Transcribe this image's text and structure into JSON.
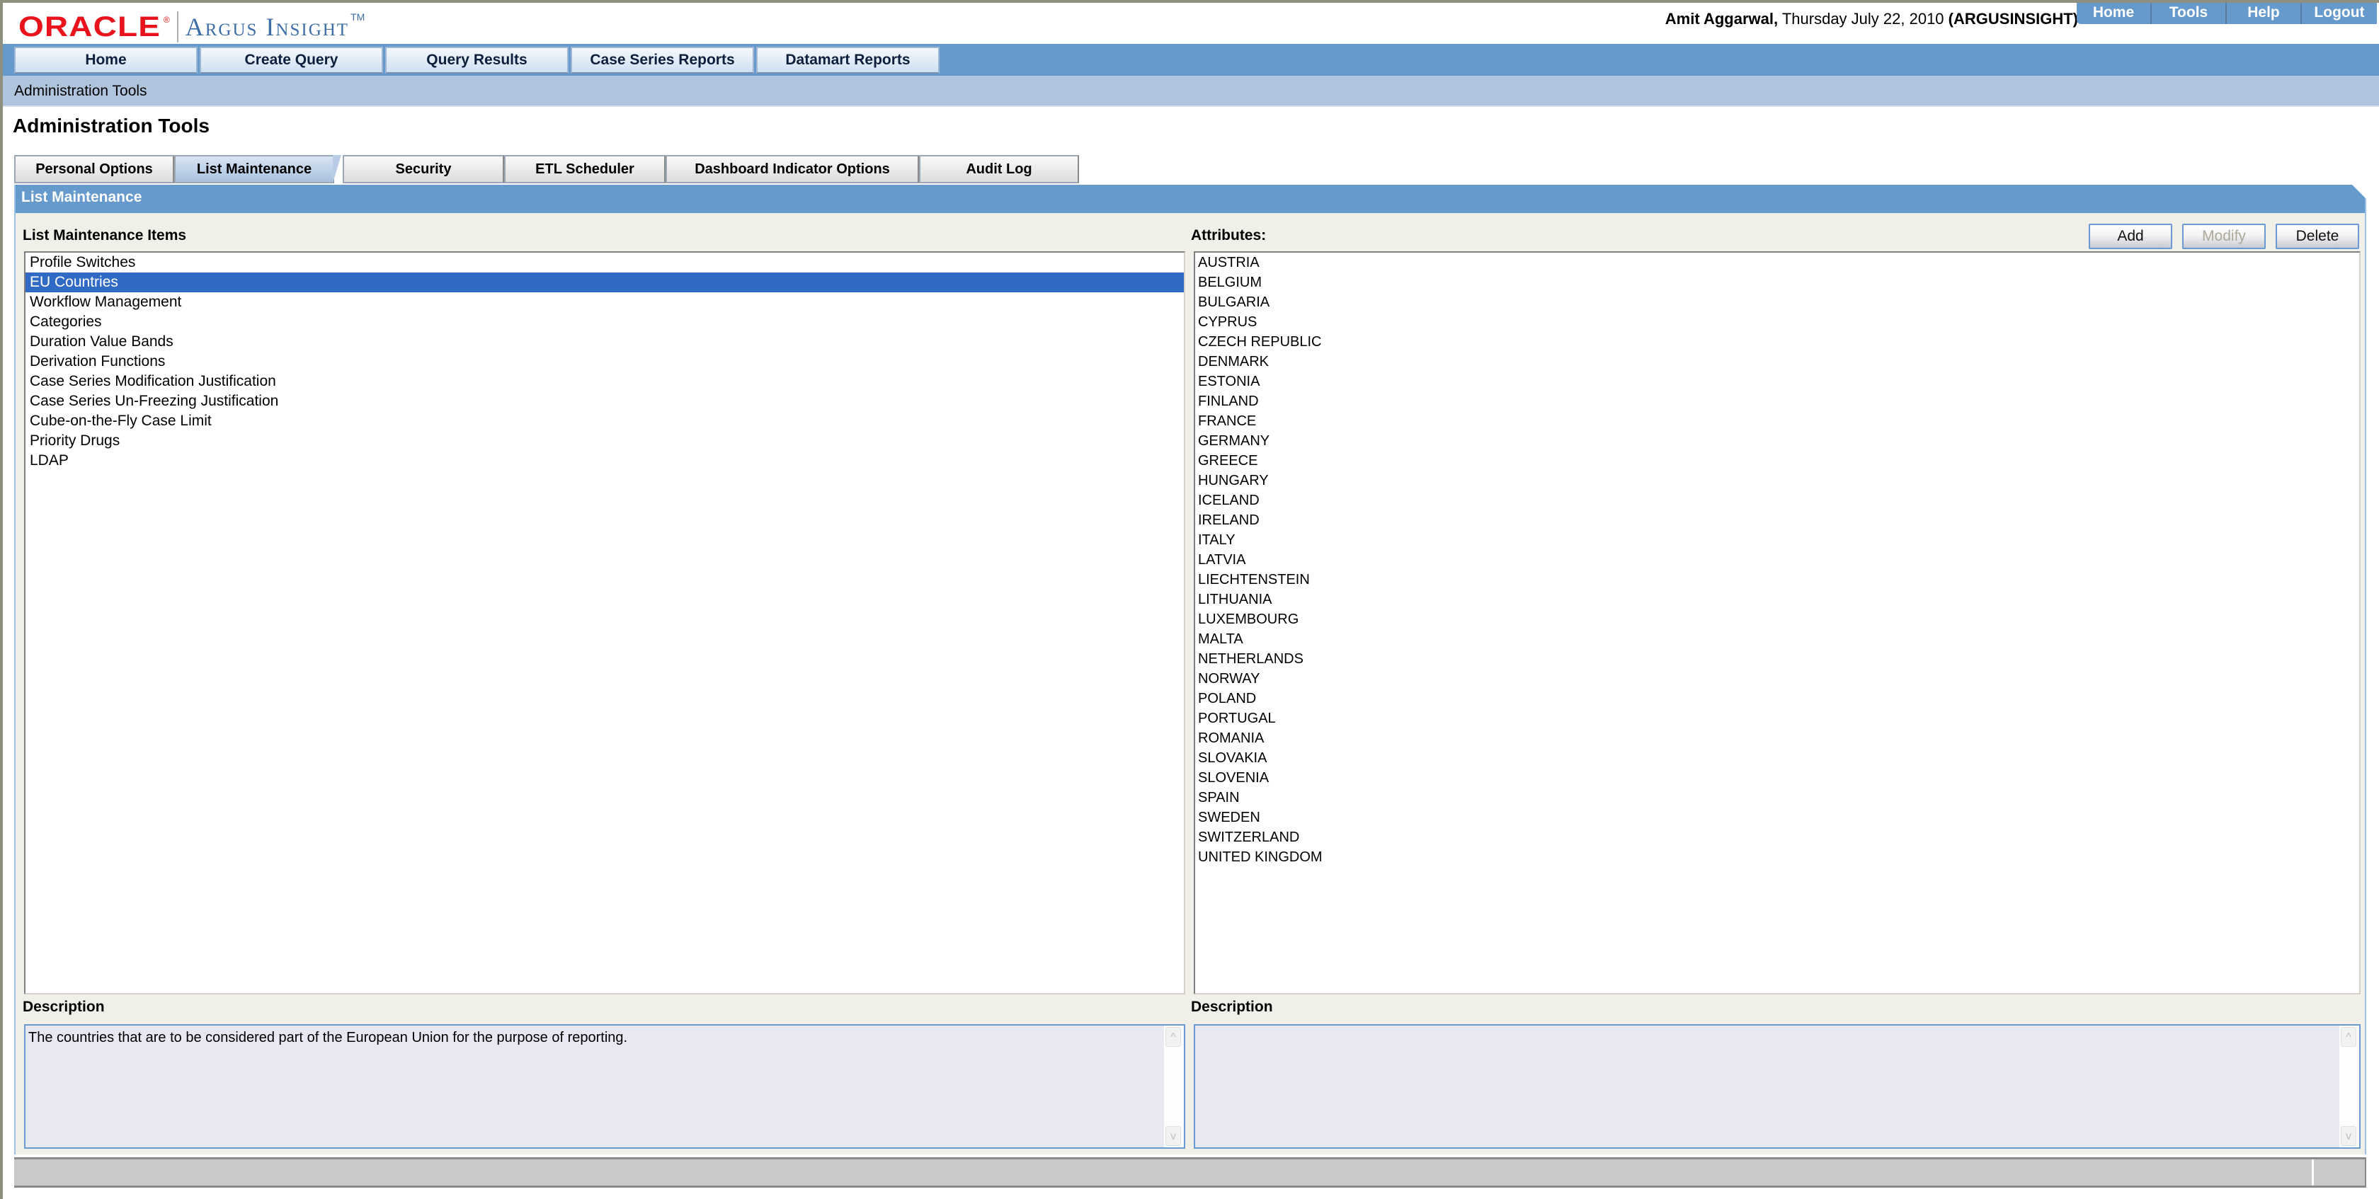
{
  "header": {
    "logo_brand": "ORACLE",
    "logo_product": "Argus Insight",
    "logo_tm": "TM",
    "user_name": "Amit Aggarwal,",
    "date_text": "Thursday July 22, 2010",
    "database": "(ARGUSINSIGHT)",
    "top_links": [
      "Home",
      "Tools",
      "Help",
      "Logout"
    ]
  },
  "main_nav": {
    "items": [
      "Home",
      "Create Query",
      "Query Results",
      "Case Series Reports",
      "Datamart Reports"
    ]
  },
  "breadcrumb": "Administration Tools",
  "page_title": "Administration Tools",
  "tabs": {
    "items": [
      "Personal Options",
      "List Maintenance",
      "Security",
      "ETL Scheduler",
      "Dashboard Indicator Options",
      "Audit Log"
    ],
    "active": "List Maintenance"
  },
  "panel": {
    "title": "List Maintenance",
    "items_label": "List Maintenance Items",
    "attributes_label": "Attributes:",
    "buttons": {
      "add": "Add",
      "modify": "Modify",
      "delete": "Delete"
    },
    "items": [
      "Profile Switches",
      "EU Countries",
      "Workflow Management",
      "Categories",
      "Duration Value Bands",
      "Derivation Functions",
      "Case Series Modification Justification",
      "Case Series Un-Freezing Justification",
      "Cube-on-the-Fly Case Limit",
      "Priority Drugs",
      "LDAP"
    ],
    "selected_item": "EU Countries",
    "attributes": [
      "AUSTRIA",
      "BELGIUM",
      "BULGARIA",
      "CYPRUS",
      "CZECH REPUBLIC",
      "DENMARK",
      "ESTONIA",
      "FINLAND",
      "FRANCE",
      "GERMANY",
      "GREECE",
      "HUNGARY",
      "ICELAND",
      "IRELAND",
      "ITALY",
      "LATVIA",
      "LIECHTENSTEIN",
      "LITHUANIA",
      "LUXEMBOURG",
      "MALTA",
      "NETHERLANDS",
      "NORWAY",
      "POLAND",
      "PORTUGAL",
      "ROMANIA",
      "SLOVAKIA",
      "SLOVENIA",
      "SPAIN",
      "SWEDEN",
      "SWITZERLAND",
      "UNITED KINGDOM"
    ],
    "item_description_label": "Description",
    "item_description": "The countries that are to be considered part of the European Union for the purpose of reporting.",
    "attribute_description_label": "Description",
    "attribute_description": ""
  },
  "colors": {
    "nav_blue": "#6699cc",
    "crumb_blue": "#b0c4de",
    "selection": "#316ac5",
    "oracle_red": "#e8131c",
    "panel_bg": "#f0f0e8"
  }
}
